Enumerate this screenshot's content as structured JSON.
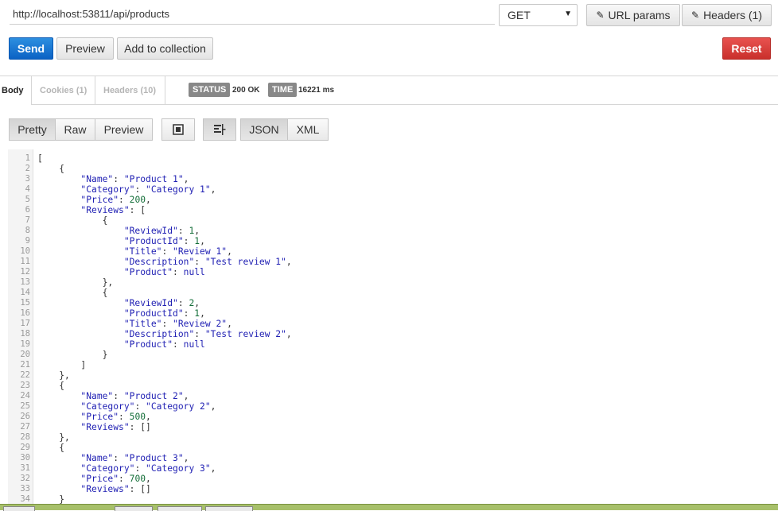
{
  "request": {
    "url": "http://localhost:53811/api/products",
    "method": "GET",
    "url_params_label": "URL params",
    "headers_label": "Headers (1)"
  },
  "actions": {
    "send_label": "Send",
    "preview_label": "Preview",
    "add_collection_label": "Add to collection",
    "reset_label": "Reset"
  },
  "response": {
    "tabs": [
      "Body",
      "Cookies (1)",
      "Headers (10)"
    ],
    "status_badge": "STATUS",
    "status_value": "200 OK",
    "time_badge": "TIME",
    "time_value": "16221 ms"
  },
  "view": {
    "modes": [
      "Pretty",
      "Raw",
      "Preview"
    ],
    "active_mode": "Pretty",
    "formats": [
      "JSON",
      "XML"
    ],
    "active_format": "JSON"
  },
  "colors": {
    "send": "#0b62c4",
    "reset": "#c9302c",
    "json_key": "#1f1fb3",
    "json_number": "#156f3a"
  },
  "body_lines": [
    "[",
    "    {",
    "        \"Name\": \"Product 1\",",
    "        \"Category\": \"Category 1\",",
    "        \"Price\": 200,",
    "        \"Reviews\": [",
    "            {",
    "                \"ReviewId\": 1,",
    "                \"ProductId\": 1,",
    "                \"Title\": \"Review 1\",",
    "                \"Description\": \"Test review 1\",",
    "                \"Product\": null",
    "            },",
    "            {",
    "                \"ReviewId\": 2,",
    "                \"ProductId\": 1,",
    "                \"Title\": \"Review 2\",",
    "                \"Description\": \"Test review 2\",",
    "                \"Product\": null",
    "            }",
    "        ]",
    "    },",
    "    {",
    "        \"Name\": \"Product 2\",",
    "        \"Category\": \"Category 2\",",
    "        \"Price\": 500,",
    "        \"Reviews\": []",
    "    },",
    "    {",
    "        \"Name\": \"Product 3\",",
    "        \"Category\": \"Category 3\",",
    "        \"Price\": 700,",
    "        \"Reviews\": []",
    "    }"
  ]
}
